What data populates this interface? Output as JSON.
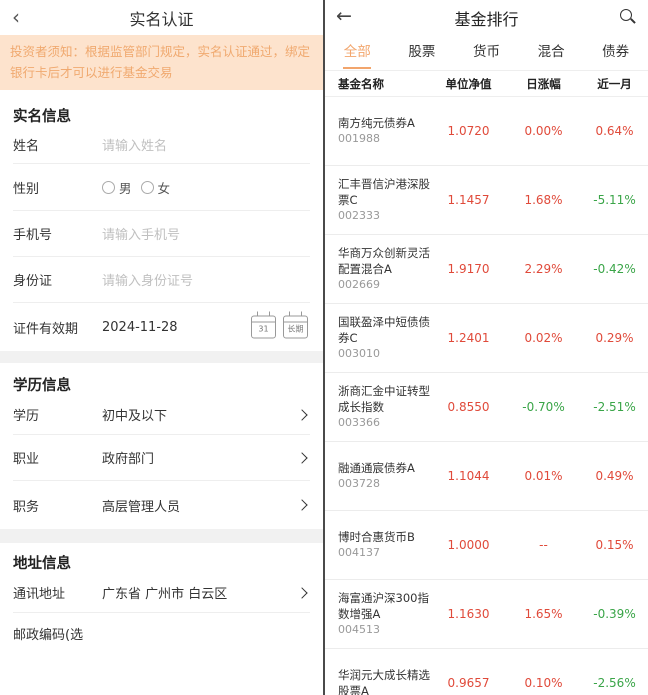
{
  "left": {
    "header": {
      "back_icon": "chevron-left-icon",
      "title": "实名认证"
    },
    "notice": "投资者须知：根据监管部门规定，实名认证通过，绑定银行卡后才可以进行基金交易",
    "realname": {
      "title": "实名信息",
      "name": {
        "label": "姓名",
        "placeholder": "请输入姓名"
      },
      "gender": {
        "label": "性别",
        "options": [
          "男",
          "女"
        ]
      },
      "phone": {
        "label": "手机号",
        "placeholder": "请输入手机号"
      },
      "idcard": {
        "label": "身份证",
        "placeholder": "请输入身份证号"
      },
      "validity": {
        "label": "证件有效期",
        "value": "2024-11-28",
        "calendar_label": "31",
        "longterm_label": "长期"
      }
    },
    "education": {
      "title": "学历信息",
      "degree": {
        "label": "学历",
        "value": "初中及以下"
      },
      "occupation": {
        "label": "职业",
        "value": "政府部门"
      },
      "position": {
        "label": "职务",
        "value": "高层管理人员"
      }
    },
    "address": {
      "title": "地址信息",
      "mail": {
        "label": "通讯地址",
        "value": "广东省 广州市 白云区"
      },
      "zip": {
        "label": "邮政编码(选"
      }
    }
  },
  "right": {
    "header": {
      "back_icon": "arrow-left-icon",
      "title": "基金排行",
      "search_icon": "search-icon"
    },
    "tabs": [
      "全部",
      "股票",
      "货币",
      "混合",
      "债券"
    ],
    "active_tab": 0,
    "accent_color": "#f2a56c",
    "columns": [
      "基金名称",
      "单位净值",
      "日涨幅",
      "近一月"
    ],
    "funds": [
      {
        "name": "南方纯元债券A",
        "code": "001988",
        "nav": "1.0720",
        "daily": "0.00%",
        "month": "0.64%",
        "month_trend": "up"
      },
      {
        "name": "汇丰晋信沪港深股票C",
        "code": "002333",
        "nav": "1.1457",
        "daily": "1.68%",
        "month": "-5.11%",
        "month_trend": "down"
      },
      {
        "name": "华商万众创新灵活配置混合A",
        "code": "002669",
        "nav": "1.9170",
        "daily": "2.29%",
        "month": "-0.42%",
        "month_trend": "down"
      },
      {
        "name": "国联盈泽中短债债券C",
        "code": "003010",
        "nav": "1.2401",
        "daily": "0.02%",
        "month": "0.29%",
        "month_trend": "up"
      },
      {
        "name": "浙商汇金中证转型成长指数",
        "code": "003366",
        "nav": "0.8550",
        "daily": "-0.70%",
        "month": "-2.51%",
        "month_trend": "down",
        "daily_trend": "down"
      },
      {
        "name": "融通通宸债券A",
        "code": "003728",
        "nav": "1.1044",
        "daily": "0.01%",
        "month": "0.49%",
        "month_trend": "up"
      },
      {
        "name": "博时合惠货币B",
        "code": "004137",
        "nav": "1.0000",
        "daily": "--",
        "month": "0.15%",
        "month_trend": "up"
      },
      {
        "name": "海富通沪深300指数增强A",
        "code": "004513",
        "nav": "1.1630",
        "daily": "1.65%",
        "month": "-0.39%",
        "month_trend": "down"
      },
      {
        "name": "华润元大成长精选股票A",
        "code": "",
        "nav": "0.9657",
        "daily": "0.10%",
        "month": "-2.56%",
        "month_trend": "down"
      }
    ]
  }
}
